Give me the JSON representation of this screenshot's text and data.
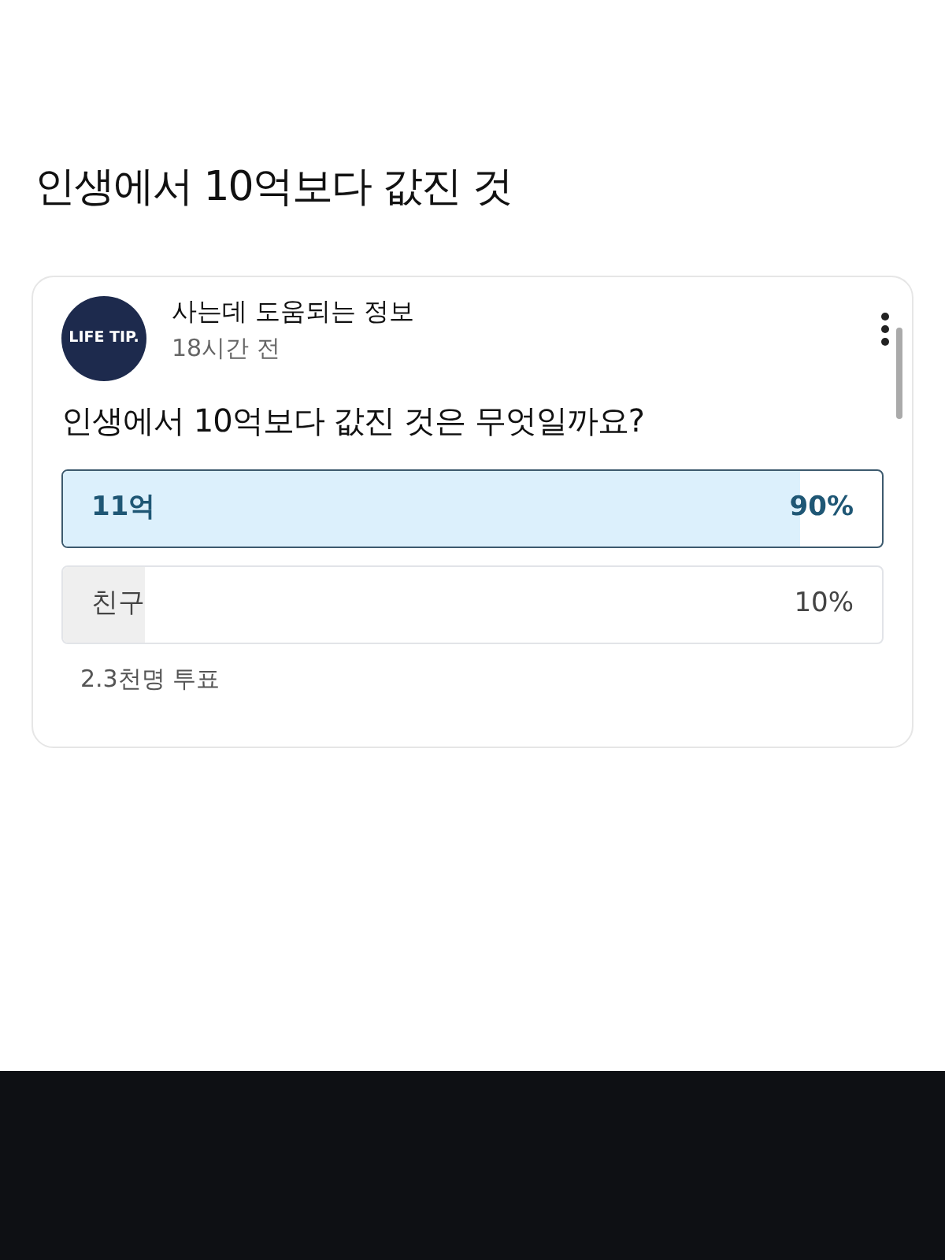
{
  "heading": "인생에서 10억보다 값진 것",
  "post": {
    "avatar_text": "LIFE TIP.",
    "author": "사는데 도움되는 정보",
    "time": "18시간 전",
    "question": "인생에서 10억보다 값진 것은 무엇일까요?",
    "options": [
      {
        "label": "11억",
        "percent": "90%",
        "level": 0.9,
        "selected": true
      },
      {
        "label": "친구",
        "percent": "10%",
        "level": 0.1,
        "selected": false
      }
    ],
    "votes": "2.3천명 투표"
  }
}
